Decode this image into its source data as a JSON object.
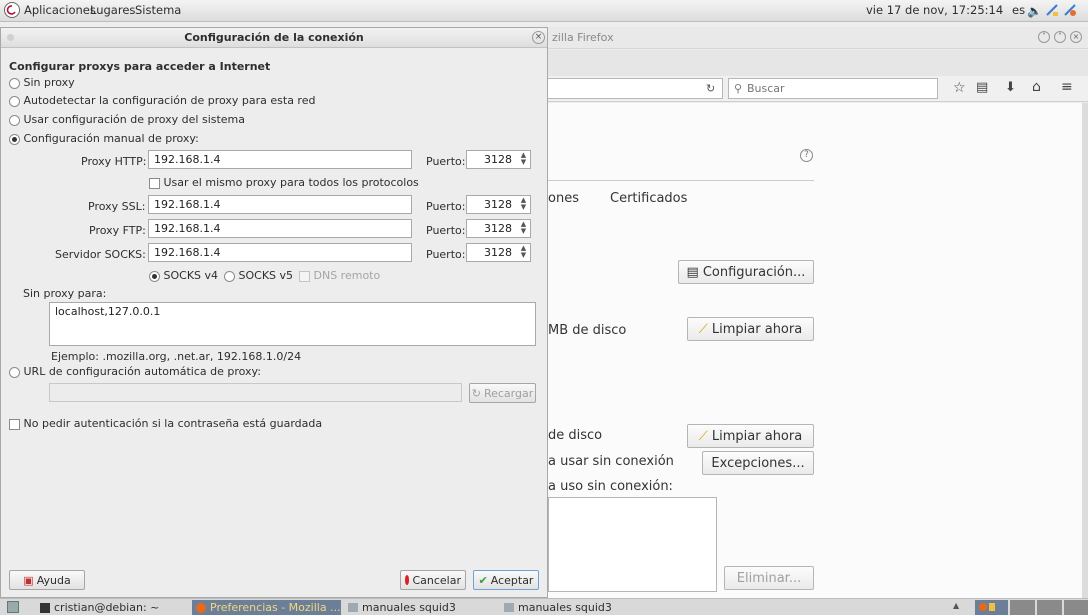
{
  "top_panel": {
    "menus": [
      "Aplicaciones",
      "Lugares",
      "Sistema"
    ],
    "clock": "vie 17 de nov, 17:25:14",
    "language": "es"
  },
  "firefox": {
    "title_fragment": "zilla Firefox",
    "search_placeholder": "Buscar",
    "tab_fragment": "ones",
    "tab_certificates": "Certificados",
    "config_button": "Configuración...",
    "disk_text_1": "MB de disco",
    "clear_now_1": "Limpiar ahora",
    "disk_text_2": "de disco",
    "clear_now_2": "Limpiar ahora",
    "offline_use": "a usar sin conexión",
    "exceptions_button": "Excepciones...",
    "offline_use_2": "a uso sin conexión:",
    "remove_button": "Eliminar..."
  },
  "dialog": {
    "title": "Configuración de la conexión",
    "heading": "Configurar proxys para acceder a Internet",
    "options": {
      "no_proxy": "Sin proxy",
      "autodetect": "Autodetectar la configuración de proxy para esta red",
      "system": "Usar configuración de proxy del sistema",
      "manual": "Configuración manual de proxy:"
    },
    "http_label": "Proxy HTTP:",
    "http_value": "192.168.1.4",
    "http_port_label": "Puerto:",
    "http_port": "3128",
    "same_proxy": "Usar el mismo proxy para todos los protocolos",
    "ssl_label": "Proxy SSL:",
    "ssl_value": "192.168.1.4",
    "ssl_port_label": "Puerto:",
    "ssl_port": "3128",
    "ftp_label": "Proxy FTP:",
    "ftp_value": "192.168.1.4",
    "ftp_port_label": "Puerto:",
    "ftp_port": "3128",
    "socks_label": "Servidor SOCKS:",
    "socks_value": "192.168.1.4",
    "socks_port_label": "Puerto:",
    "socks_port": "3128",
    "socks_v4": "SOCKS v4",
    "socks_v5": "SOCKS v5",
    "dns_remote": "DNS remoto",
    "no_proxy_for_label": "Sin proxy para:",
    "no_proxy_for_value": "localhost,127.0.0.1",
    "example": "Ejemplo: .mozilla.org, .net.ar, 192.168.1.0/24",
    "auto_url": "URL de configuración automática de proxy:",
    "reload_button": "Recargar",
    "no_auth_prompt": "No pedir autenticación si la contraseña está guardada",
    "help_button": "Ayuda",
    "cancel_button": "Cancelar",
    "accept_button": "Aceptar"
  },
  "taskbar": {
    "items": [
      "cristian@debian: ~",
      "Preferencias - Mozilla ...",
      "manuales squid3",
      "manuales squid3"
    ]
  }
}
